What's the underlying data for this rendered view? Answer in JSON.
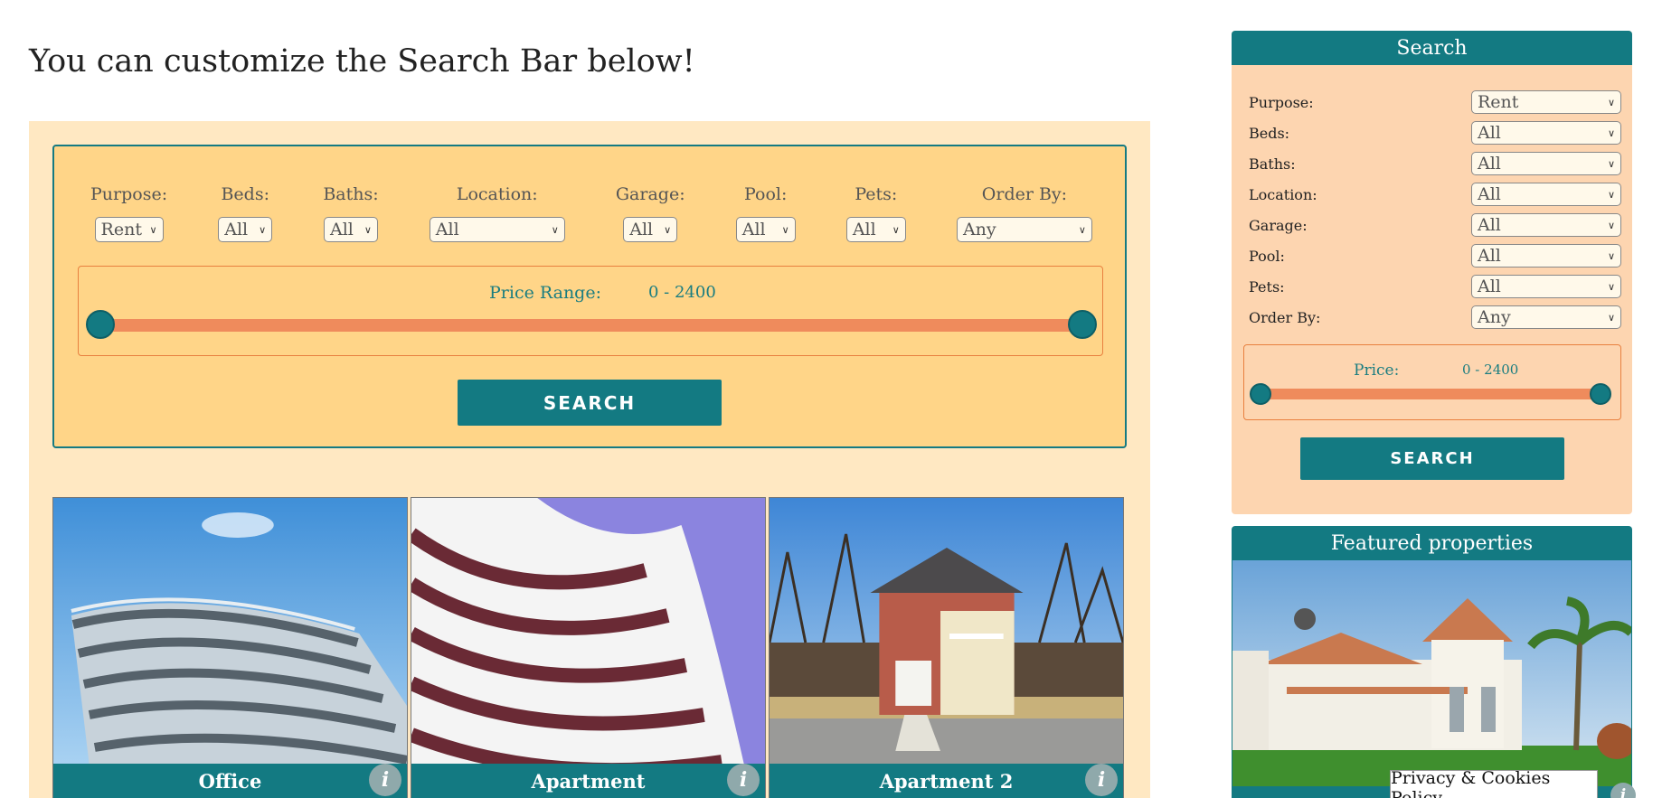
{
  "headline": "You can customize the Search Bar below!",
  "main_search": {
    "filters": [
      {
        "label": "Purpose:",
        "value": "Rent"
      },
      {
        "label": "Beds:",
        "value": "All"
      },
      {
        "label": "Baths:",
        "value": "All"
      },
      {
        "label": "Location:",
        "value": "All"
      },
      {
        "label": "Garage:",
        "value": "All"
      },
      {
        "label": "Pool:",
        "value": "All"
      },
      {
        "label": "Pets:",
        "value": "All"
      },
      {
        "label": "Order By:",
        "value": "Any"
      }
    ],
    "price_label": "Price Range:",
    "price_value": "0 - 2400",
    "button_label": "SEARCH"
  },
  "properties": [
    {
      "title": "Office",
      "info": "i"
    },
    {
      "title": "Apartment",
      "info": "i"
    },
    {
      "title": "Apartment 2",
      "info": "i"
    }
  ],
  "sidebar": {
    "title": "Search",
    "filters": [
      {
        "label": "Purpose:",
        "value": "Rent"
      },
      {
        "label": "Beds:",
        "value": "All"
      },
      {
        "label": "Baths:",
        "value": "All"
      },
      {
        "label": "Location:",
        "value": "All"
      },
      {
        "label": "Garage:",
        "value": "All"
      },
      {
        "label": "Pool:",
        "value": "All"
      },
      {
        "label": "Pets:",
        "value": "All"
      },
      {
        "label": "Order By:",
        "value": "Any"
      }
    ],
    "price_label": "Price:",
    "price_value": "0 - 2400",
    "button_label": "SEARCH"
  },
  "featured": {
    "title": "Featured properties",
    "info": "i"
  },
  "privacy_label": "Privacy & Cookies Policy",
  "colors": {
    "brand_teal": "#137a82",
    "panel_orange": "#ffd588",
    "track_orange": "#ef8b5c"
  }
}
